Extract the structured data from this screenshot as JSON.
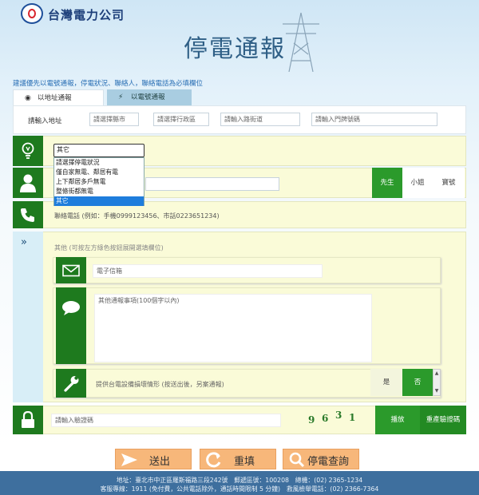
{
  "header": {
    "company_name": "台灣電力公司",
    "title": "停電通報",
    "notice": "建議優先以電號通報，停電狀況、聯絡人，聯絡電話為必填欄位"
  },
  "tabs": [
    {
      "label": "以地址通報",
      "icon": "location-pin-icon",
      "active": true
    },
    {
      "label": "以電號通報",
      "icon": "bolt-icon",
      "active": false
    }
  ],
  "address": {
    "label": "請輸入地址",
    "city_placeholder": "請選擇縣市",
    "district_placeholder": "請選擇行政區",
    "road_placeholder": "請輸入路街道",
    "number_placeholder": "請輸入門牌號碼"
  },
  "outage": {
    "selected": "其它",
    "options": [
      "請選擇停電狀況",
      "僅自家無電、鄰居有電",
      "上下鄰居多戶無電",
      "整條街都無電",
      "其它"
    ],
    "highlighted_index": 4
  },
  "contact": {
    "titles": [
      "先生",
      "小姐",
      "寶號"
    ],
    "selected_title": "先生"
  },
  "phone": {
    "placeholder": "聯絡電話 (例如：手機0999123456、市話0223651234)"
  },
  "other": {
    "hint": "其他 (可按左方綠色按鈕展開選填欄位)",
    "email_placeholder": "電子信箱",
    "message_placeholder": "其他通報事項(100個字以內)",
    "damage_label": "提供台電設備損壞情形 (按送出後，另案通報)",
    "yes": "是",
    "no": "否"
  },
  "captcha": {
    "placeholder": "請輸入驗證碼",
    "digits": [
      "9",
      "6",
      "3",
      "1"
    ],
    "play_label": "播放",
    "regenerate_label": "重產驗證碼"
  },
  "actions": {
    "submit": "送出",
    "reset": "重填",
    "query": "停電查詢"
  },
  "footer": {
    "line1": "地址：臺北市中正區羅斯福路三段242號　郵遞區號：100208　總機：(02) 2365-1234",
    "line2": "客服專線：1911 (免付費，公共電話除外，通話時間限制 5 分鐘)　救風檢舉電話：(02) 2366-7364"
  },
  "colors": {
    "green": "#2b9a2b",
    "dark_green": "#1e7a1e",
    "orange": "#f7b77a",
    "footer_blue": "#3e6f9e",
    "title_blue": "#2f5f86"
  }
}
